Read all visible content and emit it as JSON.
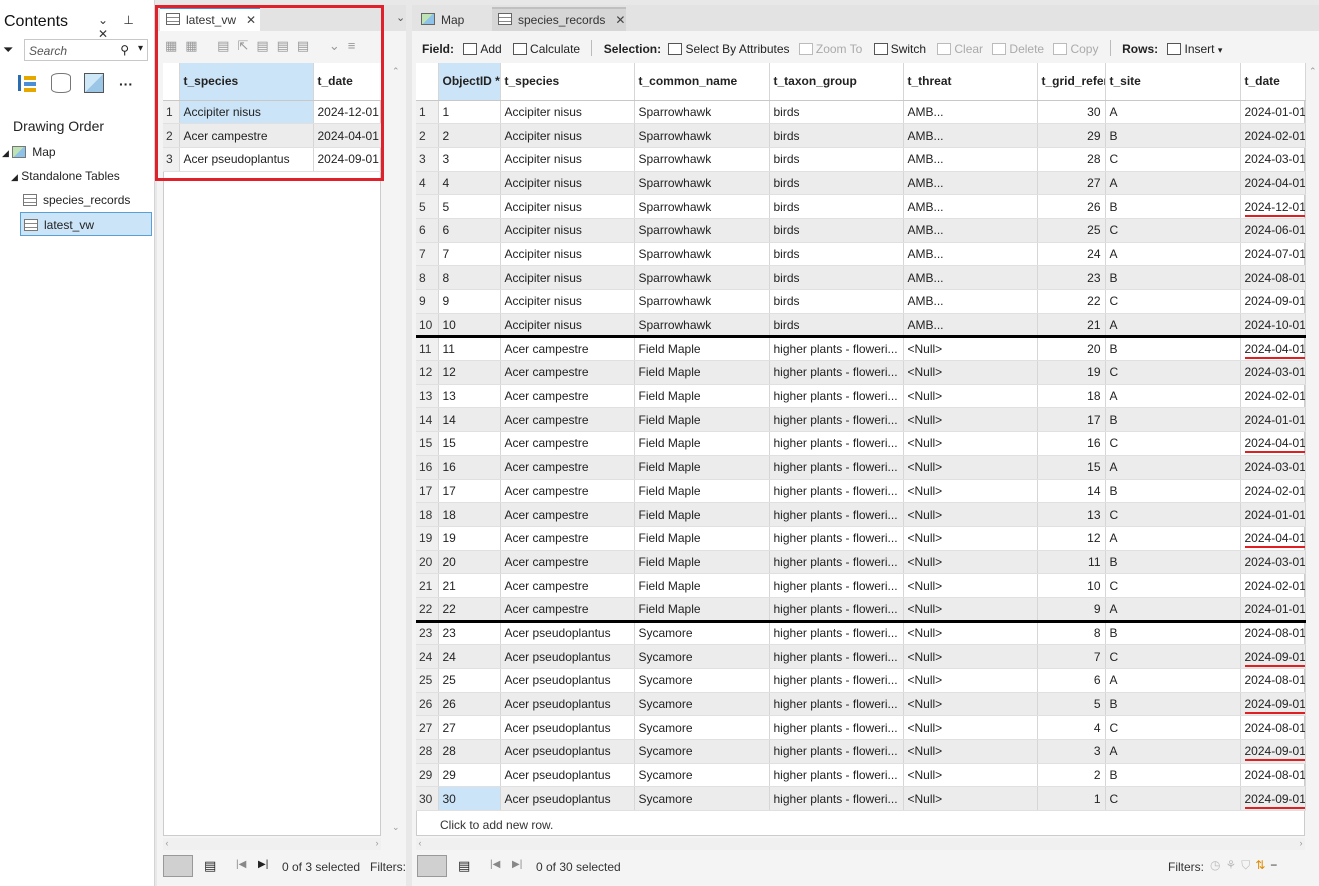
{
  "contents": {
    "title": "Contents",
    "search_placeholder": "Search",
    "drawing_order": "Drawing Order",
    "map": "Map",
    "standalone_tables": "Standalone Tables",
    "items": [
      "species_records",
      "latest_vw"
    ]
  },
  "left_table": {
    "tab": "latest_vw",
    "columns": [
      "t_species",
      "t_date"
    ],
    "rows": [
      [
        "1",
        "Accipiter nisus",
        "2024-12-01"
      ],
      [
        "2",
        "Acer campestre",
        "2024-04-01"
      ],
      [
        "3",
        "Acer pseudoplantus",
        "2024-09-01"
      ]
    ],
    "status": "0 of 3 selected",
    "filters": "Filters:"
  },
  "tabs": {
    "map": "Map",
    "species": "species_records"
  },
  "toolbar": {
    "field": "Field:",
    "add": "Add",
    "calculate": "Calculate",
    "selection": "Selection:",
    "select_by_attr": "Select By Attributes",
    "zoom_to": "Zoom To",
    "switch": "Switch",
    "clear": "Clear",
    "delete": "Delete",
    "copy": "Copy",
    "rows": "Rows:",
    "insert": "Insert"
  },
  "main_table": {
    "columns": [
      "ObjectID *",
      "t_species",
      "t_common_name",
      "t_taxon_group",
      "t_threat",
      "t_grid_refer",
      "t_site",
      "t_date"
    ],
    "rows": [
      [
        "1",
        "1",
        "Accipiter nisus",
        "Sparrowhawk",
        "birds",
        "AMB...",
        "30",
        "A",
        "2024-01-01"
      ],
      [
        "2",
        "2",
        "Accipiter nisus",
        "Sparrowhawk",
        "birds",
        "AMB...",
        "29",
        "B",
        "2024-02-01"
      ],
      [
        "3",
        "3",
        "Accipiter nisus",
        "Sparrowhawk",
        "birds",
        "AMB...",
        "28",
        "C",
        "2024-03-01"
      ],
      [
        "4",
        "4",
        "Accipiter nisus",
        "Sparrowhawk",
        "birds",
        "AMB...",
        "27",
        "A",
        "2024-04-01"
      ],
      [
        "5",
        "5",
        "Accipiter nisus",
        "Sparrowhawk",
        "birds",
        "AMB...",
        "26",
        "B",
        "2024-12-01"
      ],
      [
        "6",
        "6",
        "Accipiter nisus",
        "Sparrowhawk",
        "birds",
        "AMB...",
        "25",
        "C",
        "2024-06-01"
      ],
      [
        "7",
        "7",
        "Accipiter nisus",
        "Sparrowhawk",
        "birds",
        "AMB...",
        "24",
        "A",
        "2024-07-01"
      ],
      [
        "8",
        "8",
        "Accipiter nisus",
        "Sparrowhawk",
        "birds",
        "AMB...",
        "23",
        "B",
        "2024-08-01"
      ],
      [
        "9",
        "9",
        "Accipiter nisus",
        "Sparrowhawk",
        "birds",
        "AMB...",
        "22",
        "C",
        "2024-09-01"
      ],
      [
        "10",
        "10",
        "Accipiter nisus",
        "Sparrowhawk",
        "birds",
        "AMB...",
        "21",
        "A",
        "2024-10-01"
      ],
      [
        "11",
        "11",
        "Acer campestre",
        "Field Maple",
        "higher plants - floweri...",
        "<Null>",
        "20",
        "B",
        "2024-04-01"
      ],
      [
        "12",
        "12",
        "Acer campestre",
        "Field Maple",
        "higher plants - floweri...",
        "<Null>",
        "19",
        "C",
        "2024-03-01"
      ],
      [
        "13",
        "13",
        "Acer campestre",
        "Field Maple",
        "higher plants - floweri...",
        "<Null>",
        "18",
        "A",
        "2024-02-01"
      ],
      [
        "14",
        "14",
        "Acer campestre",
        "Field Maple",
        "higher plants - floweri...",
        "<Null>",
        "17",
        "B",
        "2024-01-01"
      ],
      [
        "15",
        "15",
        "Acer campestre",
        "Field Maple",
        "higher plants - floweri...",
        "<Null>",
        "16",
        "C",
        "2024-04-01"
      ],
      [
        "16",
        "16",
        "Acer campestre",
        "Field Maple",
        "higher plants - floweri...",
        "<Null>",
        "15",
        "A",
        "2024-03-01"
      ],
      [
        "17",
        "17",
        "Acer campestre",
        "Field Maple",
        "higher plants - floweri...",
        "<Null>",
        "14",
        "B",
        "2024-02-01"
      ],
      [
        "18",
        "18",
        "Acer campestre",
        "Field Maple",
        "higher plants - floweri...",
        "<Null>",
        "13",
        "C",
        "2024-01-01"
      ],
      [
        "19",
        "19",
        "Acer campestre",
        "Field Maple",
        "higher plants - floweri...",
        "<Null>",
        "12",
        "A",
        "2024-04-01"
      ],
      [
        "20",
        "20",
        "Acer campestre",
        "Field Maple",
        "higher plants - floweri...",
        "<Null>",
        "11",
        "B",
        "2024-03-01"
      ],
      [
        "21",
        "21",
        "Acer campestre",
        "Field Maple",
        "higher plants - floweri...",
        "<Null>",
        "10",
        "C",
        "2024-02-01"
      ],
      [
        "22",
        "22",
        "Acer campestre",
        "Field Maple",
        "higher plants - floweri...",
        "<Null>",
        "9",
        "A",
        "2024-01-01"
      ],
      [
        "23",
        "23",
        "Acer pseudoplantus",
        "Sycamore",
        "higher plants - floweri...",
        "<Null>",
        "8",
        "B",
        "2024-08-01"
      ],
      [
        "24",
        "24",
        "Acer pseudoplantus",
        "Sycamore",
        "higher plants - floweri...",
        "<Null>",
        "7",
        "C",
        "2024-09-01"
      ],
      [
        "25",
        "25",
        "Acer pseudoplantus",
        "Sycamore",
        "higher plants - floweri...",
        "<Null>",
        "6",
        "A",
        "2024-08-01"
      ],
      [
        "26",
        "26",
        "Acer pseudoplantus",
        "Sycamore",
        "higher plants - floweri...",
        "<Null>",
        "5",
        "B",
        "2024-09-01"
      ],
      [
        "27",
        "27",
        "Acer pseudoplantus",
        "Sycamore",
        "higher plants - floweri...",
        "<Null>",
        "4",
        "C",
        "2024-08-01"
      ],
      [
        "28",
        "28",
        "Acer pseudoplantus",
        "Sycamore",
        "higher plants - floweri...",
        "<Null>",
        "3",
        "A",
        "2024-09-01"
      ],
      [
        "29",
        "29",
        "Acer pseudoplantus",
        "Sycamore",
        "higher plants - floweri...",
        "<Null>",
        "2",
        "B",
        "2024-08-01"
      ],
      [
        "30",
        "30",
        "Acer pseudoplantus",
        "Sycamore",
        "higher plants - floweri...",
        "<Null>",
        "1",
        "C",
        "2024-09-01"
      ]
    ],
    "underlined_rows": [
      5,
      11,
      15,
      19,
      24,
      26,
      28,
      30
    ],
    "group_start_rows": [
      11,
      23
    ],
    "add_row": "Click to add new row.",
    "status": "0 of 30 selected",
    "filters": "Filters:"
  },
  "colors": {
    "highlight": "#e0202a",
    "selection": "#cce4f7"
  }
}
